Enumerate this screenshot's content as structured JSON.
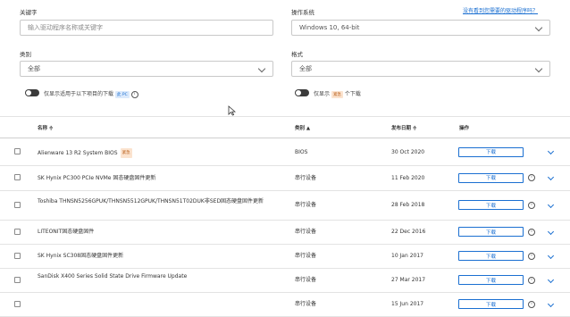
{
  "filters": {
    "keyword_label": "关键字",
    "keyword_placeholder": "输入驱动程序名称或关键字",
    "os_label": "操作系统",
    "os_value": "Windows 10, 64-bit",
    "help_link": "没有看到您需要的驱动程序吗？",
    "category_label": "类别",
    "category_value": "全部",
    "format_label": "格式",
    "format_value": "全部",
    "toggle1_label": "仅显示适用于以下项目的下载",
    "toggle1_badge": "此 PC",
    "toggle2_label": "仅显示",
    "toggle2_badge": "紧急",
    "toggle2_suffix": "个下载"
  },
  "table": {
    "headers": {
      "name": "名称 ≑",
      "category": "类别 ▲",
      "date": "发布日期 ≑",
      "action": "操作"
    },
    "rows": [
      {
        "name": "Alienware 13 R2 System BIOS",
        "badge": "紧急",
        "category": "BIOS",
        "date": "30 Oct 2020",
        "action": "下载",
        "info": false
      },
      {
        "name": "SK Hynix PC300 PCIe NVMe 固态硬盘固件更新",
        "badge": "",
        "category": "串行设备",
        "date": "11 Feb 2020",
        "action": "下载",
        "info": true
      },
      {
        "name": "Toshiba THNSN5256GPUK/THNSN5512GPUK/THNSN51T02DUK非SED固态硬盘固件更新",
        "badge": "",
        "category": "串行设备",
        "date": "28 Feb 2018",
        "action": "下载",
        "info": true
      },
      {
        "name": "LITEONIT固态硬盘固件",
        "badge": "",
        "category": "串行设备",
        "date": "22 Dec 2016",
        "action": "下载",
        "info": true
      },
      {
        "name": "SK Hynix SC308固态硬盘固件更新",
        "badge": "",
        "category": "串行设备",
        "date": "10 Jan 2017",
        "action": "下载",
        "info": true
      },
      {
        "name": "SanDisk X400 Series Solid State Drive Firmware Update",
        "badge": "",
        "category": "串行设备",
        "date": "27 Mar 2017",
        "action": "下载",
        "info": true
      },
      {
        "name": "",
        "badge": "",
        "category": "串行设备",
        "date": "15 Jun 2017",
        "action": "下载",
        "info": true
      }
    ]
  },
  "icons": {
    "chevron": "chevron-down-icon",
    "info": "info-icon",
    "cursor": "mouse-cursor-icon"
  },
  "colors": {
    "accent": "#1a6fd1",
    "badge_orange_bg": "#fbe3cf",
    "badge_blue_bg": "#dbe9fb"
  }
}
